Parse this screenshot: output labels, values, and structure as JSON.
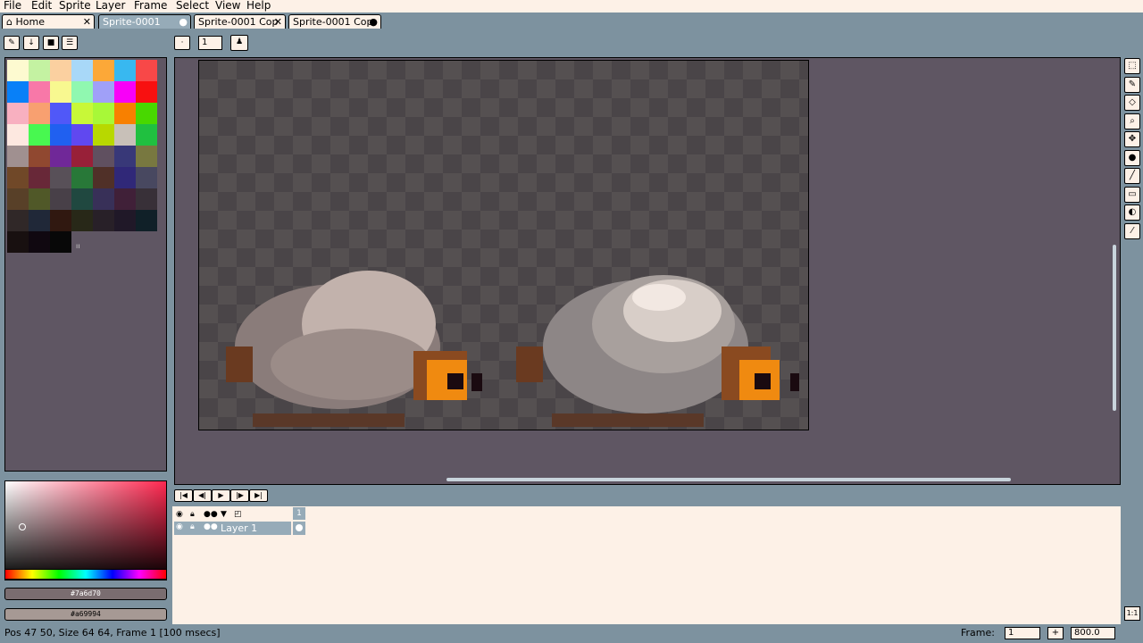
{
  "menu": [
    "File",
    "Edit",
    "Sprite",
    "Layer",
    "Frame",
    "Select",
    "View",
    "Help"
  ],
  "tabs": [
    {
      "label": "Home",
      "close": "✕"
    },
    {
      "label": "Sprite-0001",
      "close": "●"
    },
    {
      "label": "Sprite-0001 Cop",
      "close": "✕"
    },
    {
      "label": "Sprite-0001 Cop",
      "close": "●"
    }
  ],
  "toolbar": {
    "zoom_value": "1"
  },
  "palette_colors": [
    "#fdfad0",
    "#c4f2a2",
    "#fbd0a0",
    "#a8d8f8",
    "#fca838",
    "#38b8f0",
    "#f84848",
    "#0880f8",
    "#f878a8",
    "#f8f890",
    "#90f8b0",
    "#a0a0f8",
    "#f800f8",
    "#f81010",
    "#f8b0c0",
    "#f8a070",
    "#5058f8",
    "#c8f838",
    "#a8f838",
    "#f88000",
    "#48d800",
    "#fde8e0",
    "#48f850",
    "#2060f0",
    "#6048f0",
    "#b8d800",
    "#c8c0b8",
    "#20c040",
    "#a09090",
    "#904830",
    "#702898",
    "#982038",
    "#605060",
    "#383878",
    "#787840",
    "#704828",
    "#682838",
    "#585058",
    "#287838",
    "#503028",
    "#302878",
    "#484860",
    "#584028",
    "#505828",
    "#484048",
    "#204840",
    "#383058",
    "#402038",
    "#383038",
    "#302828",
    "#202838",
    "#301810",
    "#282818",
    "#282028",
    "#201828",
    "#102028",
    "#181010",
    "#100810",
    "#080808"
  ],
  "colors": {
    "fg_hex": "#7a6d70",
    "bg_hex": "#a69994",
    "fg": "#7a6d70",
    "bg": "#a69994"
  },
  "timeline": {
    "frame_header": "1",
    "layer_name": "Layer 1",
    "nav_buttons": [
      "first-frame-icon",
      "prev-frame-icon",
      "play-icon",
      "next-frame-icon",
      "last-frame-icon"
    ]
  },
  "status": {
    "text": "Pos 47 50, Size 64 64, Frame 1 [100 msecs]",
    "frame_label": "Frame:",
    "frame_value": "1",
    "plus": "+",
    "zoom": "800.0"
  },
  "tools": [
    "marquee-icon",
    "pencil-icon",
    "eraser-icon",
    "zoom-icon",
    "move-icon",
    "bucket-icon",
    "line-icon",
    "rectangle-icon",
    "blur-icon",
    "eyedropper-icon"
  ]
}
